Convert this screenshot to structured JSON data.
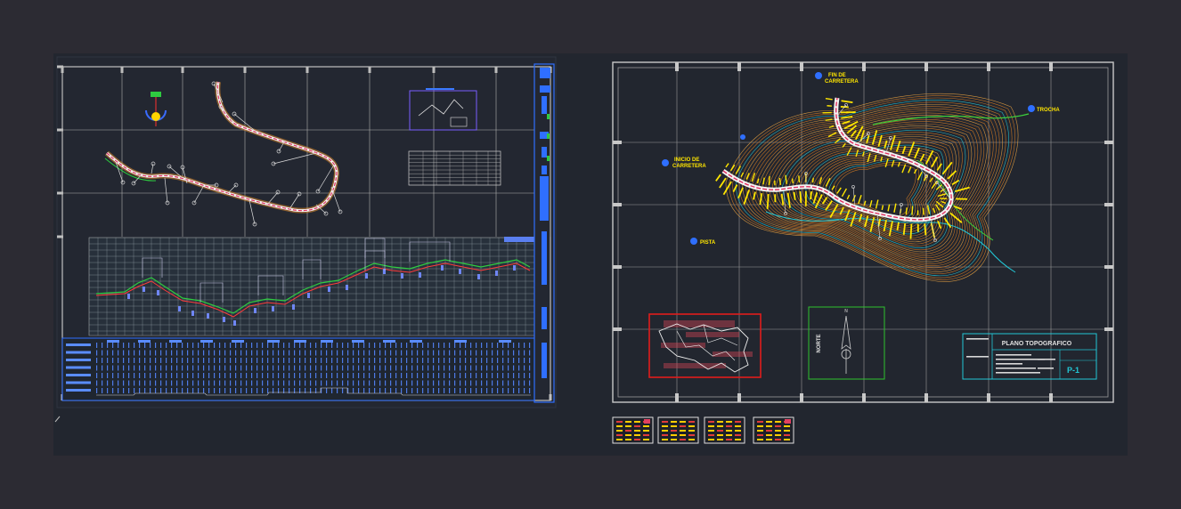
{
  "colors": {
    "page_bg": "#2c2b33",
    "model_bg": "#22262f",
    "sheet_frame": "#c8c8c8",
    "grid": "#b8b8b8",
    "road_axis": "#e03060",
    "road_edge": "#f0f0f0",
    "contour_orange": "#e08a2a",
    "contour_cyan": "#22c7d6",
    "contour_green": "#3ccf3c",
    "label_yellow": "#ffe600",
    "title_block": "#22c7d6",
    "location_frame": "#e01c1c",
    "north_frame": "#2ec22e",
    "profile_blue": "#5a7ff0",
    "profile_red": "#ff3a3a"
  },
  "left_sheet": {
    "plan_view": {
      "name": "road-plan-view"
    },
    "cross_table": {
      "name": "alignment-data-table"
    },
    "profile": {
      "name": "longitudinal-profile"
    },
    "data_band": {
      "name": "profile-data-band"
    }
  },
  "right_sheet": {
    "labels": {
      "fin_line1": "FIN DE",
      "fin_line2": "CARRETERA",
      "inicio_line1": "INICIO DE",
      "inicio_line2": "CARRETERA",
      "trocha": "TROCHA",
      "pista": "PISTA"
    },
    "north_text": "NORTE",
    "title_block": {
      "title": "PLANO TOPOGRAFICO",
      "sheet_code": "P-1"
    }
  },
  "layout_tabs": [
    "layout-1",
    "layout-2",
    "layout-3",
    "layout-4"
  ]
}
